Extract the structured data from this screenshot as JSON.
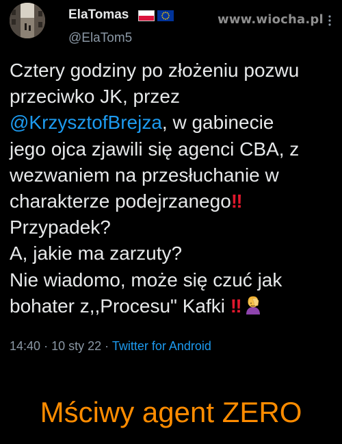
{
  "user": {
    "display_name": "ElaTomas",
    "handle": "@ElaTom5",
    "flags": [
      "pl-flag-icon",
      "eu-flag-icon"
    ]
  },
  "watermark": "www.wiocha.pl",
  "tweet": {
    "lines": [
      {
        "text": "Cztery godziny po złożeniu pozwu"
      },
      {
        "text": "przeciwko JK, przez"
      },
      {
        "mention": "@KrzysztofBrejza",
        "text": ", w gabinecie"
      },
      {
        "text": "jego ojca zjawili się agenci CBA, z"
      },
      {
        "text": "wezwaniem na przesłuchanie w"
      },
      {
        "text": "charakterze podejrzanego",
        "emoji": "‼"
      },
      {
        "text": "Przypadek?"
      },
      {
        "text": "A, jakie ma zarzuty?"
      },
      {
        "text": "Nie wiadomo, może się czuć jak"
      },
      {
        "text": "bohater z,,Procesu\" Kafki ",
        "emoji": "‼"
      }
    ]
  },
  "meta": {
    "time": "14:40",
    "date": "10 sty 22",
    "separator": "·",
    "source": "Twitter for Android"
  },
  "caption": "Mściwy agent ZERO",
  "colors": {
    "background": "#000000",
    "text": "#e7e9ea",
    "secondary": "#8b98a5",
    "link": "#1d9bf0",
    "caption": "#ff8c00",
    "bang_emoji": "#e0182d"
  }
}
